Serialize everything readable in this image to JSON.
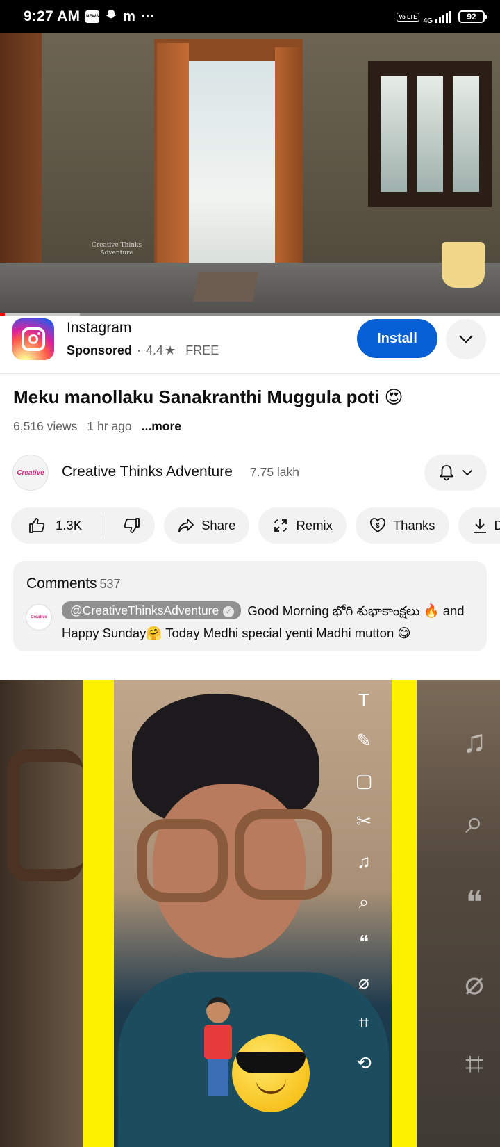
{
  "status_bar": {
    "time": "9:27 AM",
    "notification_icons": [
      "news-icon",
      "snapchat-icon",
      "m-app-icon",
      "more-dots-icon"
    ],
    "volte": "Vo LTE",
    "network": "4G",
    "battery": "92"
  },
  "video": {
    "watermark": "Creative Thinks Adventure",
    "progress_played": 0.01,
    "progress_buffered": 0.16,
    "colors": {
      "progress": "#ff0000"
    }
  },
  "ad": {
    "app_name": "Instagram",
    "sponsored": "Sponsored",
    "rating": "4.4",
    "star": "★",
    "price": "FREE",
    "install_label": "Install",
    "colors": {
      "install": "#065fd4"
    }
  },
  "video_info": {
    "title": "Meku manollaku Sanakranthi Muggula poti 😍",
    "views": "6,516 views",
    "age": "1 hr ago",
    "more": "...more"
  },
  "channel": {
    "name": "Creative Thinks Adventure",
    "subscribers": "7.75 lakh",
    "avatar_text": "Creative"
  },
  "actions": {
    "likes": "1.3K",
    "share": "Share",
    "remix": "Remix",
    "thanks": "Thanks",
    "download": "Dow"
  },
  "comments": {
    "heading": "Comments",
    "count": "537",
    "top_comment": {
      "mention": "@CreativeThinksAdventure",
      "text": "Good Morning  భోగి శుభాకాంక్షలు  🔥 and  Happy Sunday🤗 Today Medhi special yenti Madhi mutton 😋"
    }
  },
  "next_video": {
    "tool_icons": [
      "text-tool-icon",
      "pencil-icon",
      "sticker-icon",
      "scissors-icon",
      "music-icon",
      "lens-search-icon",
      "quote-icon",
      "paperclip-icon",
      "crop-icon",
      "loop-icon"
    ]
  }
}
